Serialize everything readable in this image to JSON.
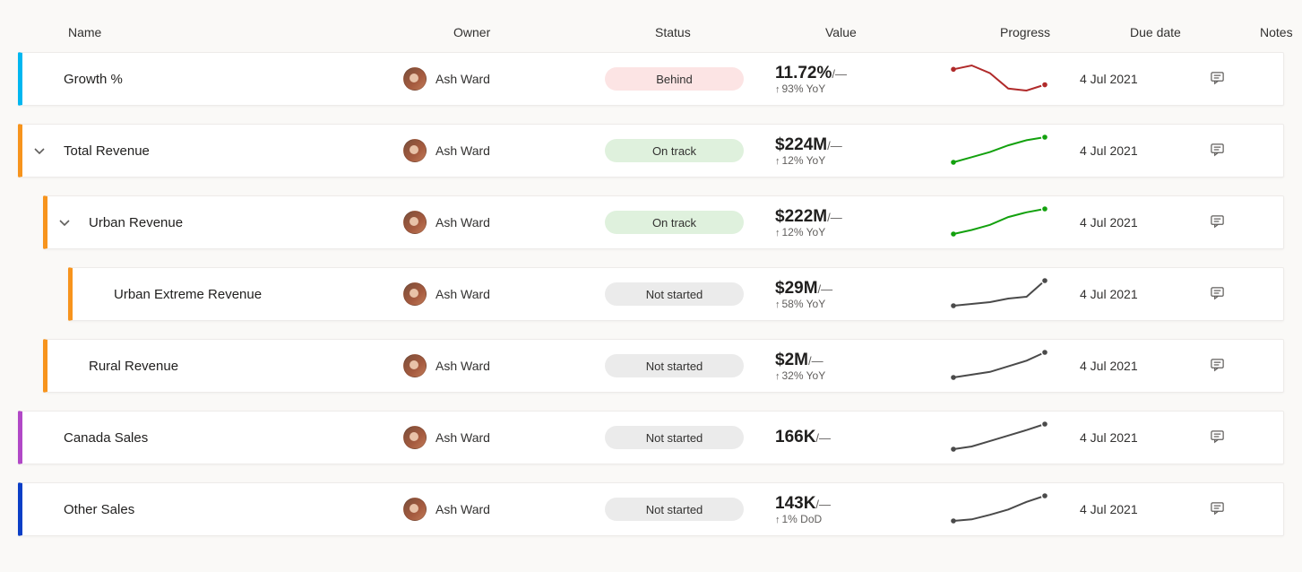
{
  "columns": {
    "name": "Name",
    "owner": "Owner",
    "status": "Status",
    "value": "Value",
    "progress": "Progress",
    "due": "Due date",
    "notes": "Notes"
  },
  "owner_name": "Ash Ward",
  "status_labels": {
    "behind": "Behind",
    "ontrack": "On track",
    "notstarted": "Not started"
  },
  "rows": [
    {
      "id": "growth",
      "indent": 0,
      "accent": "cyan",
      "expandable": false,
      "name": "Growth %",
      "status": "behind",
      "value": "11.72%",
      "target": "/—",
      "sub": "93% YoY",
      "spark": "red",
      "due": "4 Jul 2021",
      "notes": true
    },
    {
      "id": "total-revenue",
      "indent": 0,
      "accent": "orange",
      "expandable": true,
      "name": "Total Revenue",
      "status": "ontrack",
      "value": "$224M",
      "target": "/—",
      "sub": "12% YoY",
      "spark": "green",
      "due": "4 Jul 2021",
      "notes": true
    },
    {
      "id": "urban-revenue",
      "indent": 1,
      "accent": "orange",
      "expandable": true,
      "name": "Urban Revenue",
      "status": "ontrack",
      "value": "$222M",
      "target": "/—",
      "sub": "12% YoY",
      "spark": "green",
      "due": "4 Jul 2021",
      "notes": true
    },
    {
      "id": "urban-extreme-revenue",
      "indent": 2,
      "accent": "orange",
      "expandable": false,
      "name": "Urban Extreme Revenue",
      "status": "notstarted",
      "value": "$29M",
      "target": "/—",
      "sub": "58% YoY",
      "spark": "gray",
      "due": "4 Jul 2021",
      "notes": true
    },
    {
      "id": "rural-revenue",
      "indent": 1,
      "accent": "orange",
      "expandable": false,
      "name": "Rural Revenue",
      "status": "notstarted",
      "value": "$2M",
      "target": "/—",
      "sub": "32% YoY",
      "spark": "gray",
      "due": "4 Jul 2021",
      "notes": true
    },
    {
      "id": "canada-sales",
      "indent": 0,
      "accent": "purple",
      "expandable": false,
      "name": "Canada Sales",
      "status": "notstarted",
      "value": "166K",
      "target": "/—",
      "sub": "",
      "spark": "gray",
      "due": "4 Jul 2021",
      "notes": true
    },
    {
      "id": "other-sales",
      "indent": 0,
      "accent": "blue",
      "expandable": false,
      "name": "Other Sales",
      "status": "notstarted",
      "value": "143K",
      "target": "/—",
      "sub": "1% DoD",
      "spark": "gray",
      "due": "4 Jul 2021",
      "notes": true
    }
  ],
  "chart_data": [
    {
      "id": "growth",
      "type": "line",
      "color": "red",
      "x": [
        0,
        1,
        2,
        3,
        4,
        5
      ],
      "y": [
        12,
        13,
        11,
        7,
        6.5,
        8
      ]
    },
    {
      "id": "total-revenue",
      "type": "line",
      "color": "green",
      "x": [
        0,
        1,
        2,
        3,
        4,
        5
      ],
      "y": [
        150,
        165,
        180,
        200,
        215,
        224
      ]
    },
    {
      "id": "urban-revenue",
      "type": "line",
      "color": "green",
      "x": [
        0,
        1,
        2,
        3,
        4,
        5
      ],
      "y": [
        148,
        160,
        175,
        198,
        212,
        222
      ]
    },
    {
      "id": "urban-extreme-revenue",
      "type": "line",
      "color": "gray",
      "x": [
        0,
        1,
        2,
        3,
        4,
        5
      ],
      "y": [
        15,
        16,
        17,
        19,
        20,
        29
      ]
    },
    {
      "id": "rural-revenue",
      "type": "line",
      "color": "gray",
      "x": [
        0,
        1,
        2,
        3,
        4,
        5
      ],
      "y": [
        1.1,
        1.2,
        1.3,
        1.5,
        1.7,
        2.0
      ]
    },
    {
      "id": "canada-sales",
      "type": "line",
      "color": "gray",
      "x": [
        0,
        1,
        2,
        3,
        4,
        5
      ],
      "y": [
        120,
        125,
        135,
        145,
        155,
        166
      ]
    },
    {
      "id": "other-sales",
      "type": "line",
      "color": "gray",
      "x": [
        0,
        1,
        2,
        3,
        4,
        5
      ],
      "y": [
        110,
        112,
        118,
        125,
        135,
        143
      ]
    }
  ]
}
